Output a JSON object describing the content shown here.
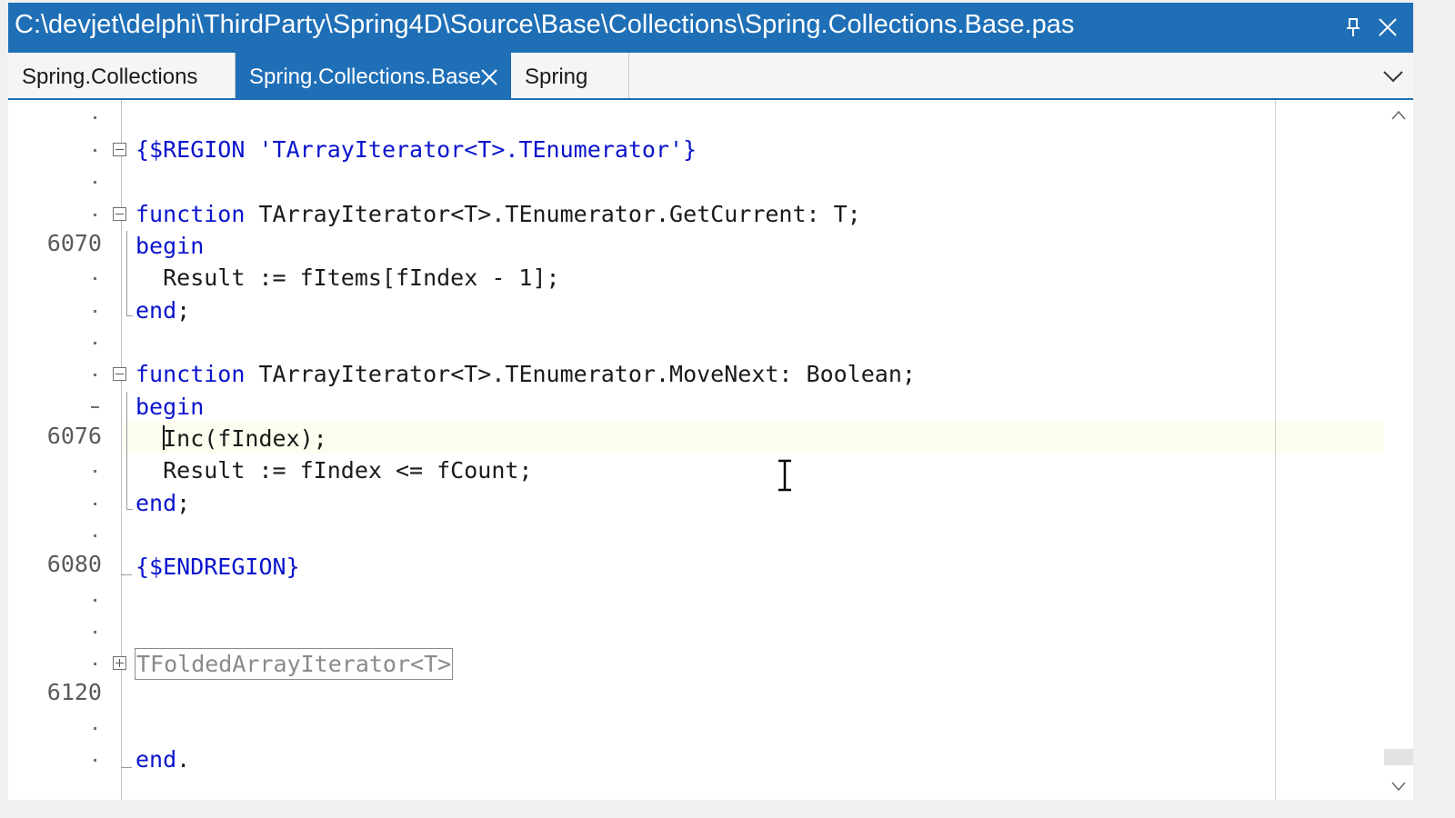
{
  "window": {
    "title": "C:\\devjet\\delphi\\ThirdParty\\Spring4D\\Source\\Base\\Collections\\Spring.Collections.Base.pas",
    "pin_icon": "pin-icon",
    "close_icon": "close-icon",
    "accent_color": "#1f6fb7"
  },
  "tabs": [
    {
      "label": "Spring.Collections",
      "active": false
    },
    {
      "label": "Spring.Collections.Base",
      "active": true
    },
    {
      "label": "Spring",
      "active": false
    }
  ],
  "line_numbers": [
    "6070",
    "6076",
    "6080",
    "6120"
  ],
  "code": {
    "region_directive": "{$REGION",
    "region_name": "'TArrayIterator<T>.TEnumerator'}",
    "fn1_kw": "function",
    "fn1_sig": " TArrayIterator<T>.TEnumerator.GetCurrent: T;",
    "begin1": "begin",
    "body1": "  Result := fItems[fIndex - 1];",
    "end1": "end",
    "end1_semi": ";",
    "fn2_kw": "function",
    "fn2_sig": " TArrayIterator<T>.TEnumerator.MoveNext: Boolean;",
    "begin2": "begin",
    "body2a": "  Inc(fIndex);",
    "body2b": "  Result := fIndex <= fCount;",
    "end2": "end",
    "end2_semi": ";",
    "endregion": "{$ENDREGION}",
    "folded_region": "TFoldedArrayIterator<T>",
    "final_end": "end",
    "final_dot": "."
  },
  "colors": {
    "keyword": "#0a14cc",
    "current_line": "#fdfdf0"
  }
}
